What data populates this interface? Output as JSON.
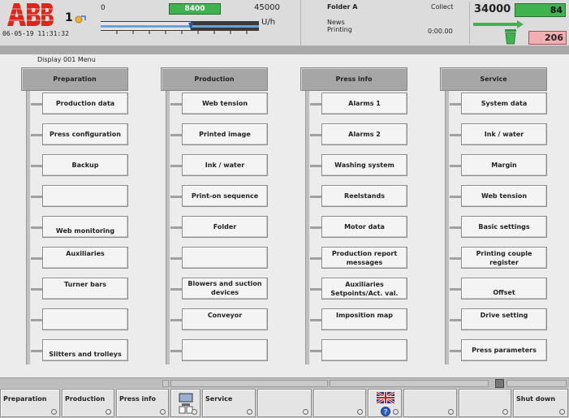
{
  "header": {
    "station_number": "1",
    "datetime": "06-05-19  11:31:32",
    "speed": {
      "min_label": "0",
      "current": "8400",
      "max_label": "45000",
      "unit": "U/h",
      "fraction": 0.57
    },
    "folder": {
      "name": "Folder A",
      "news": "News",
      "status": "Printing",
      "collect_label": "Collect",
      "collect_time": "0:00.00"
    },
    "counter": {
      "target": "34000",
      "current": "84",
      "waste": "206"
    },
    "colors": {
      "brand_red": "#e2231a",
      "good_green": "#3fb34f",
      "waste_pink": "#f3aeb4"
    }
  },
  "screen_title": "Display 001 Menu",
  "menu": {
    "columns": [
      {
        "title": "Preparation",
        "items": [
          {
            "label": "Production data",
            "slot": 0
          },
          {
            "label": "Press configuration",
            "slot": 1
          },
          {
            "label": "Backup",
            "slot": 2
          },
          {
            "label": "",
            "slot": 3
          },
          {
            "label": "Web monitoring",
            "slot": 4
          },
          {
            "label": "Auxiliaries",
            "slot": 5
          },
          {
            "label": "Turner bars",
            "slot": 6
          },
          {
            "label": "",
            "slot": 7
          },
          {
            "label": "Slitters and trolleys",
            "slot": 8
          }
        ]
      },
      {
        "title": "Production",
        "items": [
          {
            "label": "Web tension",
            "slot": 0
          },
          {
            "label": "Printed image",
            "slot": 1
          },
          {
            "label": "Ink / water",
            "slot": 2
          },
          {
            "label": "Print-on sequence",
            "slot": 3
          },
          {
            "label": "Folder",
            "slot": 4
          },
          {
            "label": "",
            "slot": 5
          },
          {
            "label": "Blowers and suction devices",
            "slot": 6
          },
          {
            "label": "Conveyor",
            "slot": 7
          },
          {
            "label": "",
            "slot": 8
          }
        ]
      },
      {
        "title": "Press info",
        "items": [
          {
            "label": "Alarms 1",
            "slot": 0
          },
          {
            "label": "Alarms 2",
            "slot": 1
          },
          {
            "label": "Washing system",
            "slot": 2
          },
          {
            "label": "Reelstands",
            "slot": 3
          },
          {
            "label": "Motor data",
            "slot": 4
          },
          {
            "label": "Production report messages",
            "slot": 5
          },
          {
            "label": "Auxiliaries Setpoints/Act. val.",
            "slot": 6
          },
          {
            "label": "Imposition map",
            "slot": 7
          },
          {
            "label": "",
            "slot": 8
          }
        ]
      },
      {
        "title": "Service",
        "items": [
          {
            "label": "System data",
            "slot": 0
          },
          {
            "label": "Ink / water",
            "slot": 1
          },
          {
            "label": "Margin",
            "slot": 2
          },
          {
            "label": "Web tension",
            "slot": 3
          },
          {
            "label": "Basic settings",
            "slot": 4
          },
          {
            "label": "Printing couple register",
            "slot": 5
          },
          {
            "label": "Offset",
            "slot": 6
          },
          {
            "label": "Drive setting",
            "slot": 7
          },
          {
            "label": "Press parameters",
            "slot": 8
          }
        ]
      }
    ]
  },
  "softkeys": [
    {
      "label": "Preparation",
      "icon": ""
    },
    {
      "label": "Production",
      "icon": ""
    },
    {
      "label": "Press info",
      "icon": ""
    },
    {
      "label": "",
      "icon": "monitor-icon"
    },
    {
      "label": "Service",
      "icon": ""
    },
    {
      "label": "",
      "icon": ""
    },
    {
      "label": "",
      "icon": ""
    },
    {
      "label": "",
      "icon": "flag-help-icon"
    },
    {
      "label": "",
      "icon": ""
    },
    {
      "label": "",
      "icon": ""
    },
    {
      "label": "Shut down",
      "icon": ""
    }
  ]
}
